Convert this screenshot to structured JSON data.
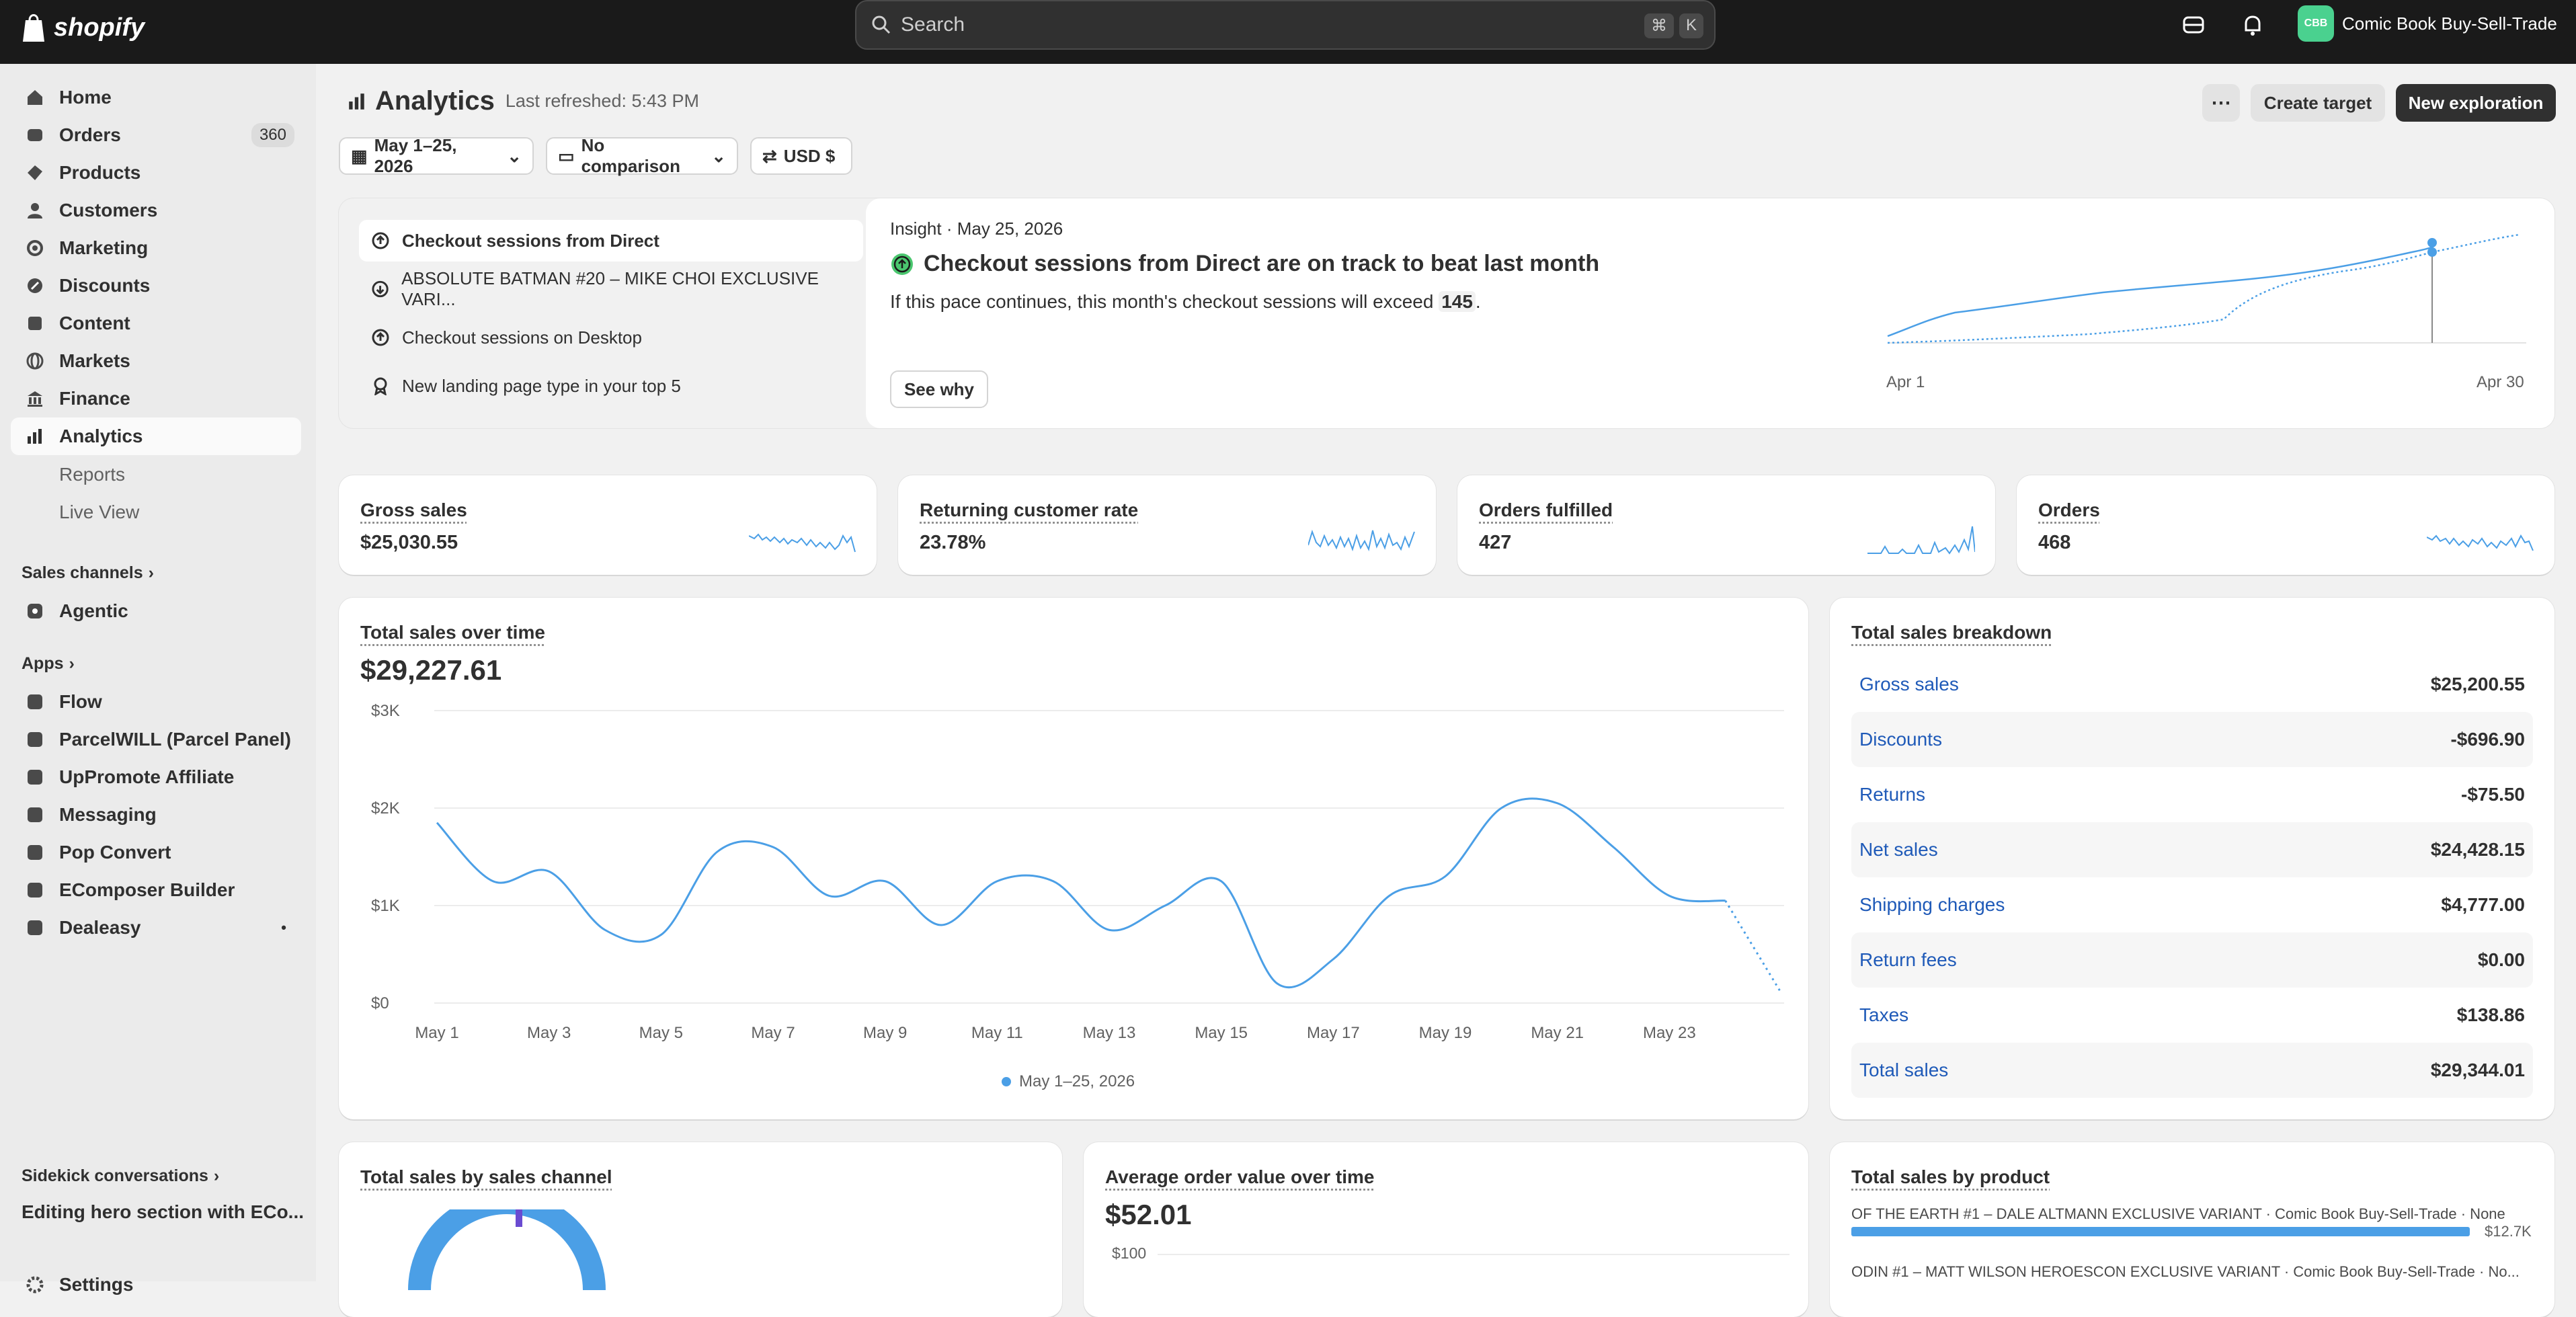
{
  "brand": {
    "logo_text": "shopify"
  },
  "search": {
    "placeholder": "Search",
    "shortcut": [
      "⌘",
      "K"
    ]
  },
  "store": {
    "avatar": "CBB",
    "name": "Comic Book Buy-Sell-Trade"
  },
  "sidebar": {
    "items": [
      {
        "label": "Home",
        "icon": "home-icon"
      },
      {
        "label": "Orders",
        "icon": "orders-icon",
        "count": "360"
      },
      {
        "label": "Products",
        "icon": "products-icon"
      },
      {
        "label": "Customers",
        "icon": "customers-icon"
      },
      {
        "label": "Marketing",
        "icon": "marketing-icon"
      },
      {
        "label": "Discounts",
        "icon": "discounts-icon"
      },
      {
        "label": "Content",
        "icon": "content-icon"
      },
      {
        "label": "Markets",
        "icon": "markets-icon"
      },
      {
        "label": "Finance",
        "icon": "finance-icon"
      },
      {
        "label": "Analytics",
        "icon": "analytics-icon",
        "active": true
      }
    ],
    "sub_items": [
      "Reports",
      "Live View"
    ],
    "sales_channels_label": "Sales channels",
    "channels": [
      "Agentic"
    ],
    "apps_label": "Apps",
    "apps": [
      "Flow",
      "ParcelWILL (Parcel Panel)",
      "UpPromote Affiliate",
      "Messaging",
      "Pop Convert",
      "EComposer Builder",
      "Dealeasy"
    ],
    "sidekick_label": "Sidekick conversations",
    "sidekick_item": "Editing hero section with ECo...",
    "settings_label": "Settings"
  },
  "header": {
    "title": "Analytics",
    "refreshed": "Last refreshed: 5:43 PM",
    "create_target": "Create target",
    "new_exploration": "New exploration"
  },
  "filters": {
    "date": "May 1–25, 2026",
    "comparison": "No comparison",
    "currency": "USD $"
  },
  "insights": {
    "list": [
      {
        "label": "Checkout sessions from Direct",
        "icon": "arrow-up-circle-icon"
      },
      {
        "label": "ABSOLUTE BATMAN #20 – MIKE CHOI EXCLUSIVE VARI...",
        "icon": "arrow-down-circle-icon"
      },
      {
        "label": "Checkout sessions on Desktop",
        "icon": "arrow-up-circle-icon"
      },
      {
        "label": "New landing page type in your top 5",
        "icon": "ribbon-icon"
      }
    ],
    "meta": "Insight · May 25, 2026",
    "headline": "Checkout sessions from Direct are on track to beat last month",
    "body_prefix": "If this pace continues, this month's checkout sessions will exceed ",
    "body_value": "145",
    "body_suffix": ".",
    "see_why": "See why",
    "chart_start": "Apr 1",
    "chart_end": "Apr 30"
  },
  "kpis": [
    {
      "label": "Gross sales",
      "value": "$25,030.55"
    },
    {
      "label": "Returning customer rate",
      "value": "23.78%"
    },
    {
      "label": "Orders fulfilled",
      "value": "427"
    },
    {
      "label": "Orders",
      "value": "468"
    }
  ],
  "sales_over_time": {
    "title": "Total sales over time",
    "total": "$29,227.61",
    "legend": "May 1–25, 2026"
  },
  "breakdown": {
    "title": "Total sales breakdown",
    "rows": [
      {
        "label": "Gross sales",
        "value": "$25,200.55"
      },
      {
        "label": "Discounts",
        "value": "-$696.90"
      },
      {
        "label": "Returns",
        "value": "-$75.50"
      },
      {
        "label": "Net sales",
        "value": "$24,428.15"
      },
      {
        "label": "Shipping charges",
        "value": "$4,777.00"
      },
      {
        "label": "Return fees",
        "value": "$0.00"
      },
      {
        "label": "Taxes",
        "value": "$138.86"
      },
      {
        "label": "Total sales",
        "value": "$29,344.01"
      }
    ]
  },
  "by_channel": {
    "title": "Total sales by sales channel"
  },
  "aov": {
    "title": "Average order value over time",
    "value": "$52.01",
    "ytick": "$100"
  },
  "by_product": {
    "title": "Total sales by product",
    "items": [
      {
        "label": "OF THE EARTH #1 – DALE ALTMANN EXCLUSIVE VARIANT · Comic Book Buy-Sell-Trade · None",
        "value": "$12.7K"
      },
      {
        "label": "ODIN #1 – MATT WILSON HEROESCON EXCLUSIVE VARIANT · Comic Book Buy-Sell-Trade · No..."
      }
    ]
  },
  "chart_data": {
    "type": "line",
    "title": "Total sales over time",
    "x": [
      "May 1",
      "May 2",
      "May 3",
      "May 4",
      "May 5",
      "May 6",
      "May 7",
      "May 8",
      "May 9",
      "May 10",
      "May 11",
      "May 12",
      "May 13",
      "May 14",
      "May 15",
      "May 16",
      "May 17",
      "May 18",
      "May 19",
      "May 20",
      "May 21",
      "May 22",
      "May 23",
      "May 24",
      "May 25"
    ],
    "xticks": [
      "May 1",
      "May 3",
      "May 5",
      "May 7",
      "May 9",
      "May 11",
      "May 13",
      "May 15",
      "May 17",
      "May 19",
      "May 21",
      "May 23"
    ],
    "yticks": [
      "$0",
      "$1K",
      "$2K",
      "$3K"
    ],
    "ylim": [
      0,
      3000
    ],
    "series": [
      {
        "name": "May 1–25, 2026",
        "values": [
          1850,
          1250,
          1350,
          750,
          700,
          1550,
          1600,
          1100,
          1250,
          800,
          1250,
          1250,
          750,
          1000,
          1250,
          200,
          450,
          1100,
          1300,
          2000,
          2050,
          1600,
          1100,
          1050,
          100
        ],
        "dashed_from_index": 23
      }
    ]
  }
}
